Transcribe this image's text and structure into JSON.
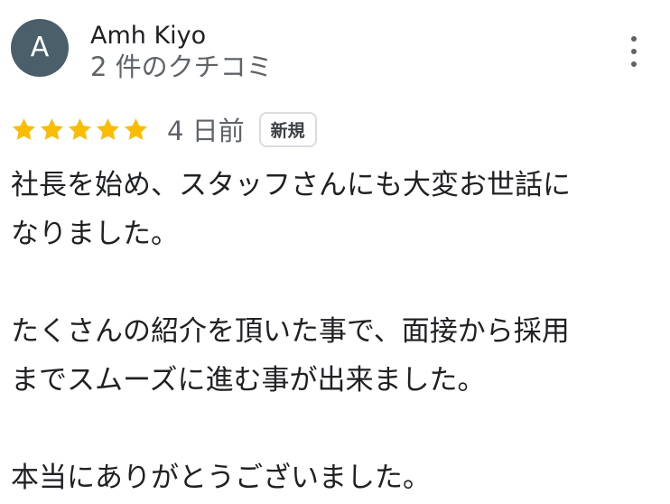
{
  "reviewer": {
    "avatar_initial": "A",
    "avatar_color": "#4b5f6b",
    "name": "Amh Kiyo",
    "review_count": "2 件のクチコミ"
  },
  "review": {
    "rating": 5,
    "max_rating": 5,
    "star_color": "#fbbc04",
    "date": "4 日前",
    "badge": "新規",
    "lines": [
      "社長を始め、スタッフさんにも大変お世話に",
      "なりました。",
      "たくさんの紹介を頂いた事で、面接から採用",
      "までスムーズに進む事が出来ました。",
      "本当にありがとうございました。"
    ]
  },
  "menu": {
    "icon": "more-vert-icon"
  }
}
